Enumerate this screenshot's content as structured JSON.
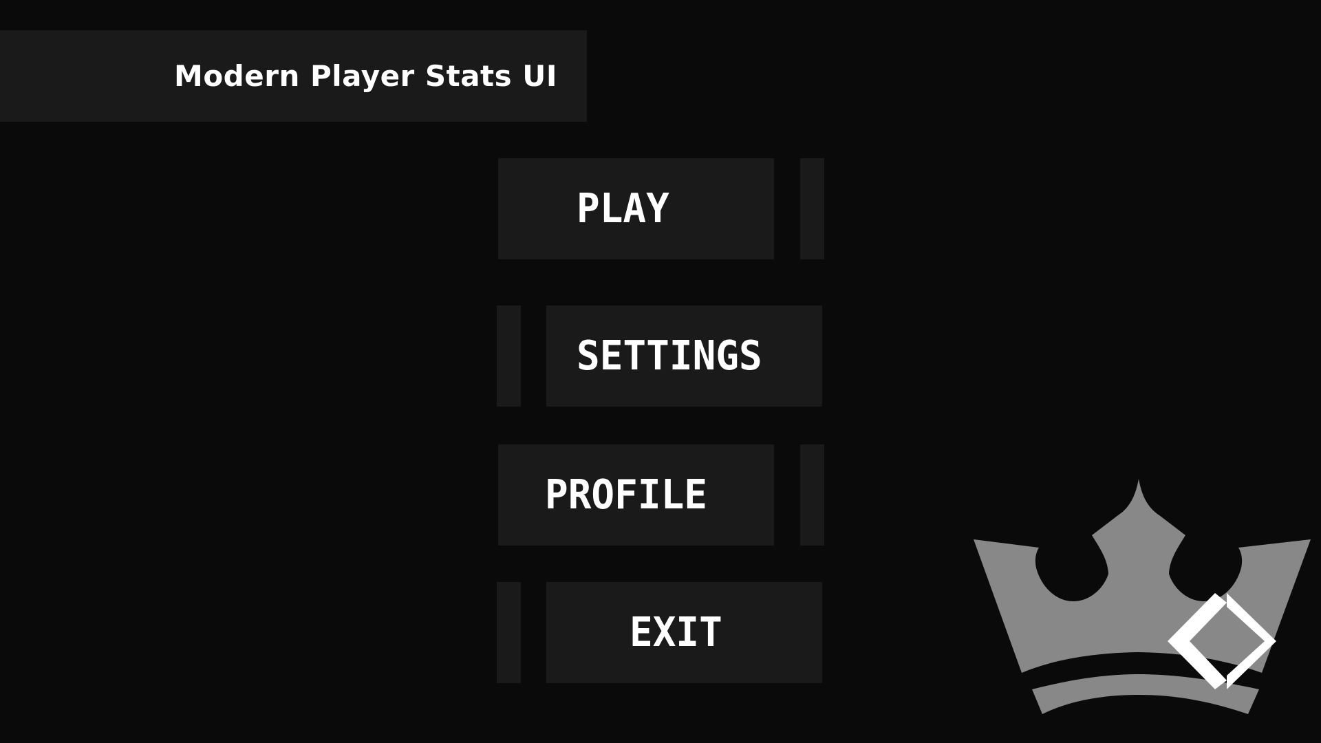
{
  "header": {
    "title": "Modern Player Stats UI"
  },
  "menu": {
    "items": [
      {
        "id": "play",
        "label": "PLAY"
      },
      {
        "id": "settings",
        "label": "SETTINGS"
      },
      {
        "id": "profile",
        "label": "PROFILE"
      },
      {
        "id": "exit",
        "label": "EXIT"
      }
    ]
  },
  "logo": {
    "icon": "crown-icon",
    "badge_icon": "diamond-brackets-icon"
  },
  "colors": {
    "background": "#0a0a0a",
    "panel": "#1a1a1a",
    "text": "#ffffff",
    "logo_gray": "#888888"
  }
}
